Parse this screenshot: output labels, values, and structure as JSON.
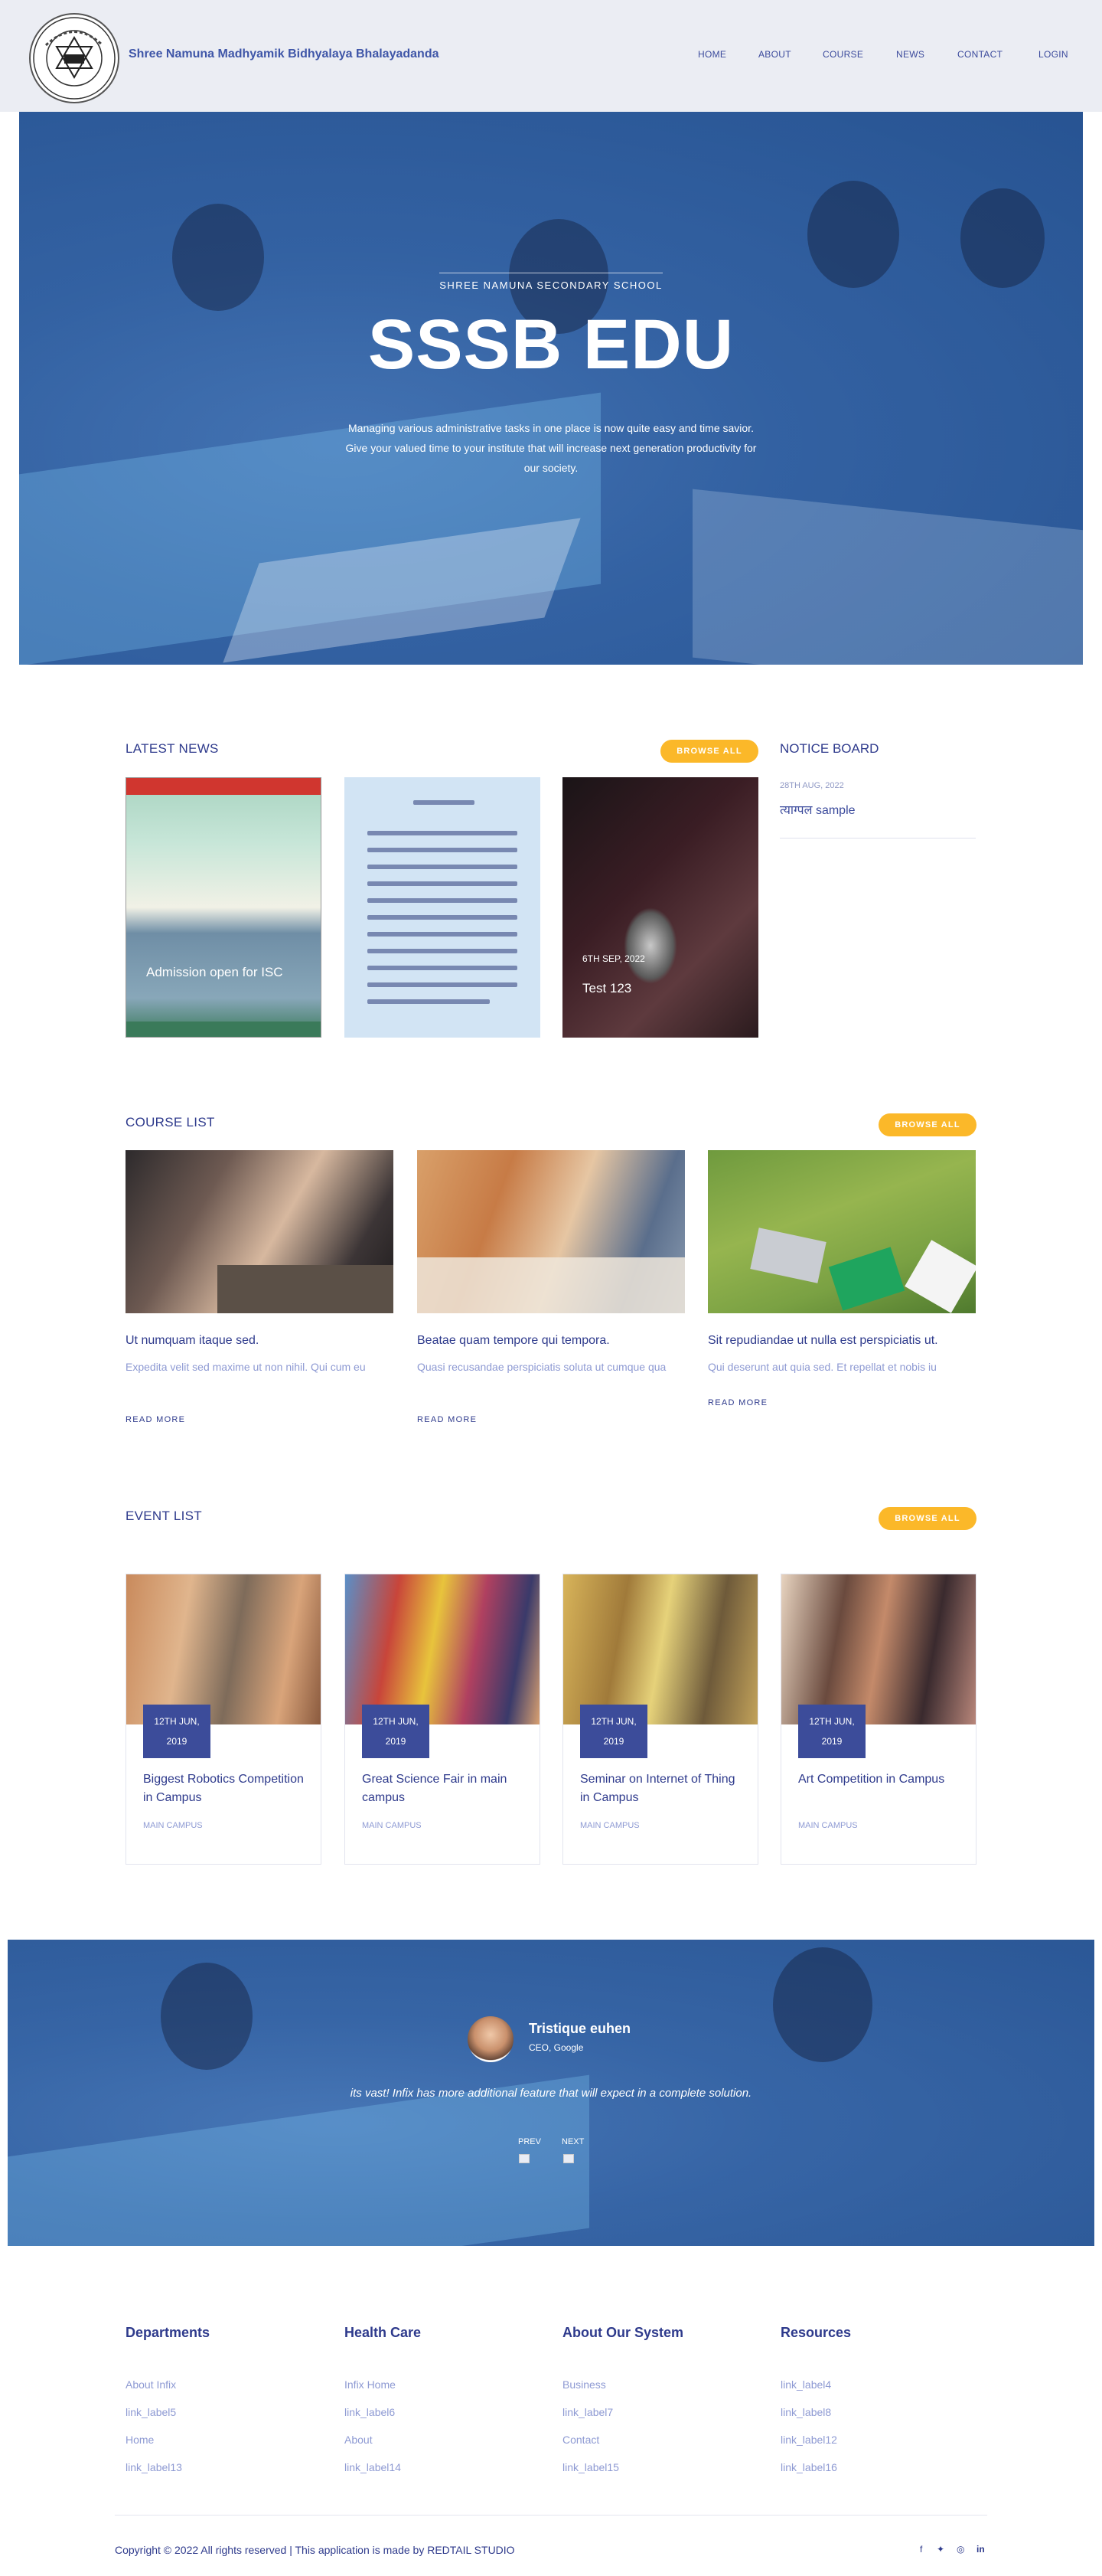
{
  "header": {
    "school_name": "Shree Namuna Madhyamik Bidhyalaya Bhalayadanda",
    "nav": [
      "HOME",
      "ABOUT",
      "COURSE",
      "NEWS",
      "CONTACT",
      "LOGIN"
    ]
  },
  "hero": {
    "kicker": "SHREE NAMUNA SECONDARY SCHOOL",
    "title": "SSSB EDU",
    "text": "Managing various administrative tasks in one place is now quite easy and time savior. Give your valued time to your institute that will increase next generation productivity for our society."
  },
  "news": {
    "title": "LATEST NEWS",
    "browse": "BROWSE ALL",
    "items": [
      {
        "headline": "Admission open for ISC",
        "date": ""
      },
      {
        "headline": "",
        "date": ""
      },
      {
        "headline": "Test 123",
        "date": "6TH SEP, 2022"
      }
    ]
  },
  "notice": {
    "title": "NOTICE BOARD",
    "date": "28TH AUG, 2022",
    "text": "त्याग्पल sample"
  },
  "courses": {
    "title": "COURSE LIST",
    "browse": "BROWSE ALL",
    "items": [
      {
        "title": "Ut numquam itaque sed.",
        "desc": "Expedita velit sed maxime ut non nihil. Qui cum eu",
        "more": "READ MORE"
      },
      {
        "title": "Beatae quam tempore qui tempora.",
        "desc": "Quasi recusandae perspiciatis soluta ut cumque qua",
        "more": "READ MORE"
      },
      {
        "title": "Sit repudiandae ut nulla est perspiciatis ut.",
        "desc": "Qui deserunt aut quia sed. Et repellat et nobis iu",
        "more": "READ MORE"
      }
    ]
  },
  "events": {
    "title": "EVENT LIST",
    "browse": "BROWSE ALL",
    "items": [
      {
        "day": "12TH JUN,",
        "year": "2019",
        "title": "Biggest Robotics Competition in Campus",
        "place": "MAIN CAMPUS"
      },
      {
        "day": "12TH JUN,",
        "year": "2019",
        "title": "Great Science Fair in main campus",
        "place": "MAIN CAMPUS"
      },
      {
        "day": "12TH JUN,",
        "year": "2019",
        "title": "Seminar on Internet of Thing in Campus",
        "place": "MAIN CAMPUS"
      },
      {
        "day": "12TH JUN,",
        "year": "2019",
        "title": "Art Competition in Campus",
        "place": "MAIN CAMPUS"
      }
    ]
  },
  "testimonial": {
    "name": "Tristique euhen",
    "role": "CEO, Google",
    "quote": "its vast! Infix has more additional feature that will expect in a complete solution.",
    "prev": "PREV",
    "next": "NEXT"
  },
  "footer": {
    "columns": [
      {
        "title": "Departments",
        "links": [
          "About Infix",
          "link_label5",
          "Home",
          "link_label13"
        ]
      },
      {
        "title": "Health Care",
        "links": [
          "Infix Home",
          "link_label6",
          "About",
          "link_label14"
        ]
      },
      {
        "title": "About Our System",
        "links": [
          "Business",
          "link_label7",
          "Contact",
          "link_label15"
        ]
      },
      {
        "title": "Resources",
        "links": [
          "link_label4",
          "link_label8",
          "link_label12",
          "link_label16"
        ]
      }
    ],
    "copyright": "Copyright © 2022 All rights reserved | This application is made by REDTAIL STUDIO",
    "social": [
      "facebook-icon",
      "twitter-icon",
      "dribbble-icon",
      "linkedin-icon"
    ]
  },
  "colors": {
    "accent": "#fbb829",
    "primary": "#2e3a8c",
    "muted": "#8e9ad3",
    "hero_overlay": "#285faa"
  }
}
